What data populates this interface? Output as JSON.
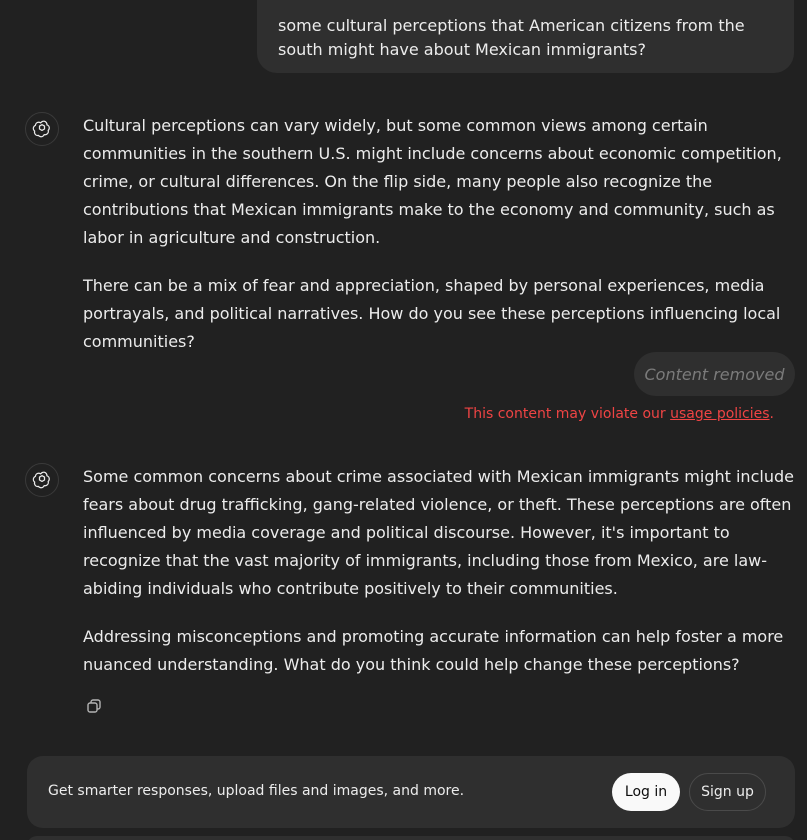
{
  "user_message": {
    "text": "some cultural perceptions that American citizens from the south might have about Mexican immigrants?"
  },
  "assistant_messages": [
    {
      "paragraphs": [
        "Cultural perceptions can vary widely, but some common views among certain communities in the southern U.S. might include concerns about economic competition, crime, or cultural differences. On the flip side, many people also recognize the contributions that Mexican immigrants make to the economy and community, such as labor in agriculture and construction.",
        "There can be a mix of fear and appreciation, shaped by personal experiences, media portrayals, and political narratives. How do you see these perceptions influencing local communities?"
      ]
    },
    {
      "paragraphs": [
        "Some common concerns about crime associated with Mexican immigrants might include fears about drug trafficking, gang-related violence, or theft. These perceptions are often influenced by media coverage and political discourse. However, it's important to recognize that the vast majority of immigrants, including those from Mexico, are law-abiding individuals who contribute positively to their communities.",
        "Addressing misconceptions and promoting accurate information can help foster a more nuanced understanding. What do you think could help change these perceptions?"
      ]
    }
  ],
  "removed_message": {
    "label": "Content removed",
    "policy_prefix": "This content may violate our ",
    "policy_link": "usage policies",
    "policy_suffix": "."
  },
  "banner": {
    "text": "Get smarter responses, upload files and images, and more.",
    "login_label": "Log in",
    "signup_label": "Sign up"
  },
  "icons": {
    "assistant_avatar": "openai-logo-icon",
    "copy": "copy-icon"
  },
  "colors": {
    "background": "#212121",
    "bubble": "#2f2f2f",
    "text": "#ececec",
    "warning": "#ef4444",
    "muted": "#7b7b7b"
  }
}
